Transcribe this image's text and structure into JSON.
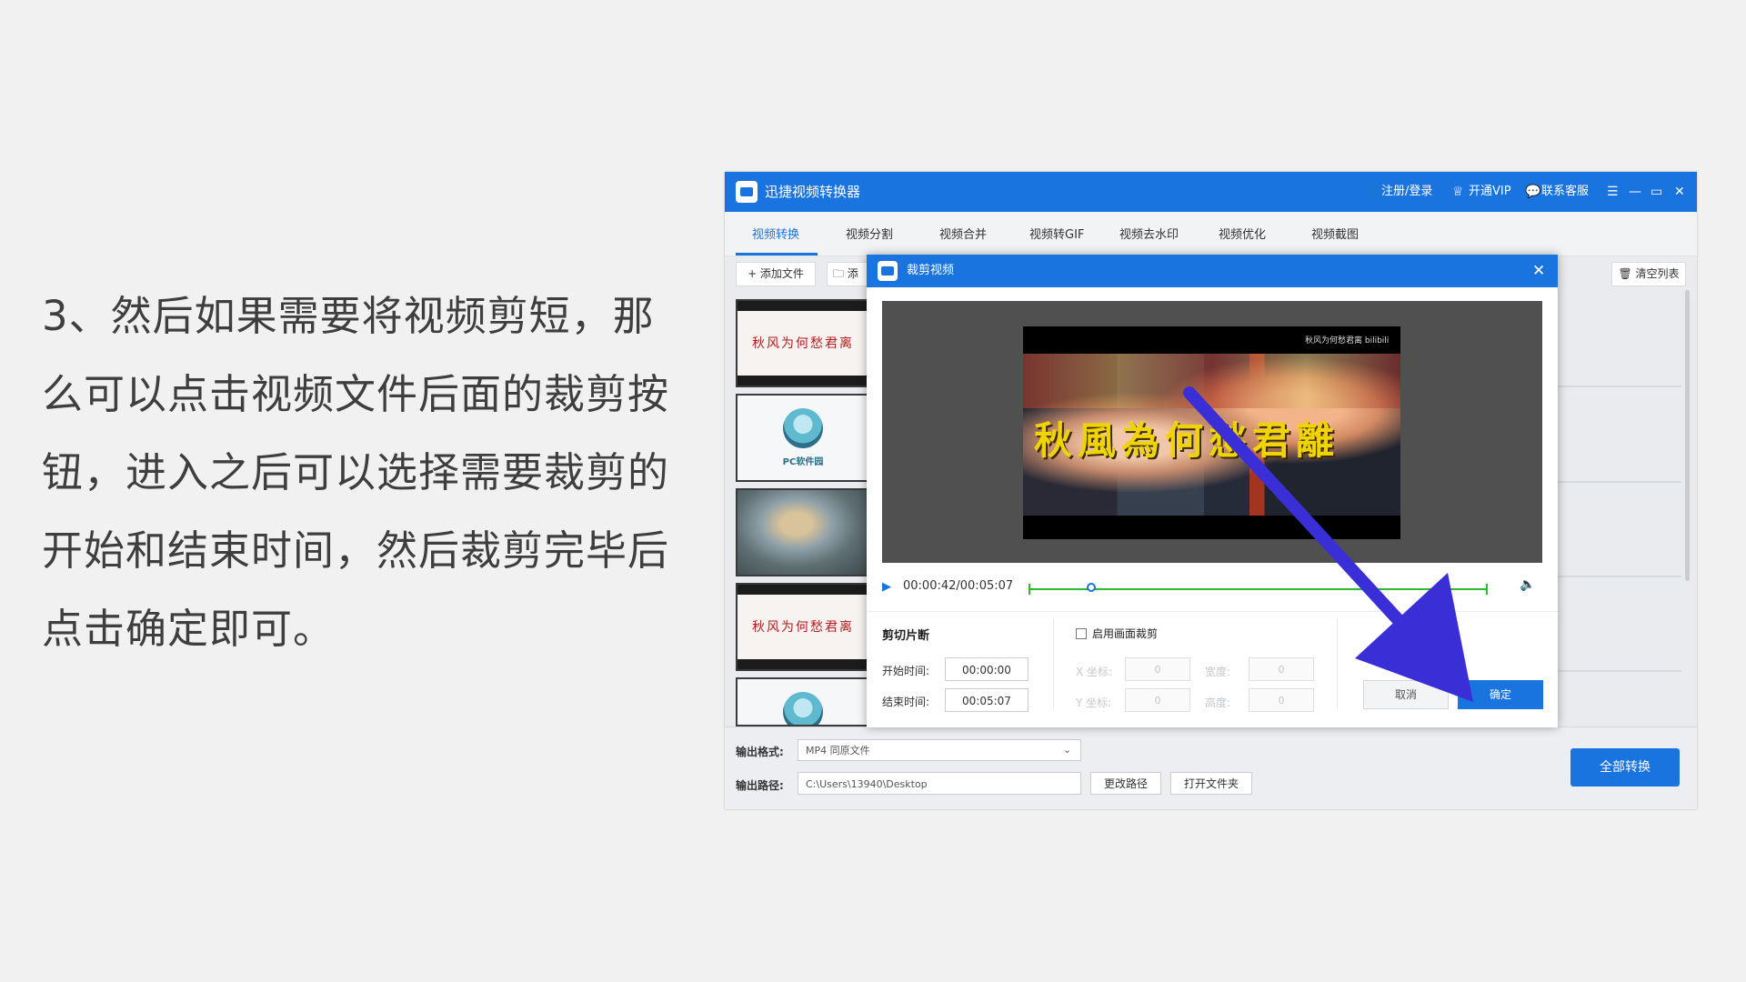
{
  "instruction": "3、然后如果需要将视频剪短，那么可以点击视频文件后面的裁剪按钮，进入之后可以选择需要裁剪的开始和结束时间，然后裁剪完毕后点击确定即可。",
  "app": {
    "title": "迅捷视频转换器",
    "header_links": {
      "login": "注册/登录",
      "vip": "开通VIP",
      "support": "联系客服"
    },
    "tabs": [
      "视频转换",
      "视频分割",
      "视频合并",
      "视频转GIF",
      "视频去水印",
      "视频优化",
      "视频截图"
    ],
    "active_tab": "视频转换",
    "toolbar": {
      "add_file": "+ 添加文件",
      "add_folder": "🗀 添",
      "clear_list": "🗑 清空列表"
    },
    "thumbnails": {
      "red_text": "秋风为何愁君离",
      "logo_text": "PC软件园"
    },
    "output": {
      "format_label": "输出格式:",
      "format_value": "MP4  同原文件",
      "path_label": "输出路径:",
      "path_value": "C:\\Users\\13940\\Desktop",
      "change_path": "更改路径",
      "open_folder": "打开文件夹",
      "convert_all": "全部转换"
    }
  },
  "dialog": {
    "title": "裁剪视频",
    "video": {
      "watermark": "秋风为何愁君离 bilibili",
      "subtitle": "秋風為何愁君離"
    },
    "player": {
      "timecode": "00:00:42/00:05:07",
      "progress": 0.137
    },
    "cut_section": {
      "title": "剪切片断",
      "start_label": "开始时间:",
      "start_value": "00:00:00",
      "end_label": "结束时间:",
      "end_value": "00:05:07"
    },
    "crop_section": {
      "enable_label": "启用画面裁剪",
      "enabled": false,
      "x_label": "X 坐标:",
      "y_label": "Y 坐标:",
      "width_label": "宽度:",
      "height_label": "高度:",
      "x_value": "0",
      "y_value": "0",
      "width_value": "0",
      "height_value": "0"
    },
    "cancel": "取消",
    "confirm": "确定"
  },
  "colors": {
    "accent": "#1a74e0",
    "track": "#2cb934",
    "annotation_arrow": "#3a2fd6"
  }
}
